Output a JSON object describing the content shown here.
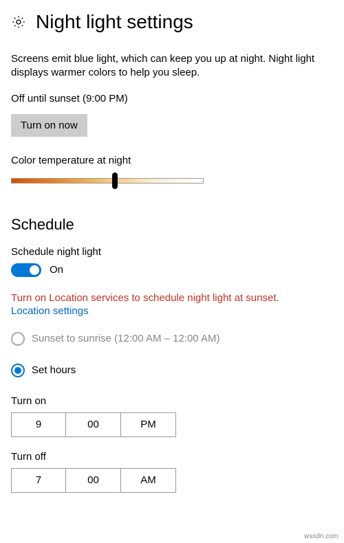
{
  "header": {
    "title": "Night light settings"
  },
  "description": "Screens emit blue light, which can keep you up at night. Night light displays warmer colors to help you sleep.",
  "status": "Off until sunset (9:00 PM)",
  "turn_on_label": "Turn on now",
  "color_temp_label": "Color temperature at night",
  "schedule_heading": "Schedule",
  "schedule_toggle_label": "Schedule night light",
  "toggle_state": "On",
  "warning_text": "Turn on Location services to schedule night light at sunset.",
  "location_link": "Location settings",
  "radio_sunset": "Sunset to sunrise (12:00 AM – 12:00 AM)",
  "radio_hours": "Set hours",
  "turn_on_section": {
    "label": "Turn on",
    "hour": "9",
    "minute": "00",
    "period": "PM"
  },
  "turn_off_section": {
    "label": "Turn off",
    "hour": "7",
    "minute": "00",
    "period": "AM"
  },
  "watermark": "wsxdn.com"
}
